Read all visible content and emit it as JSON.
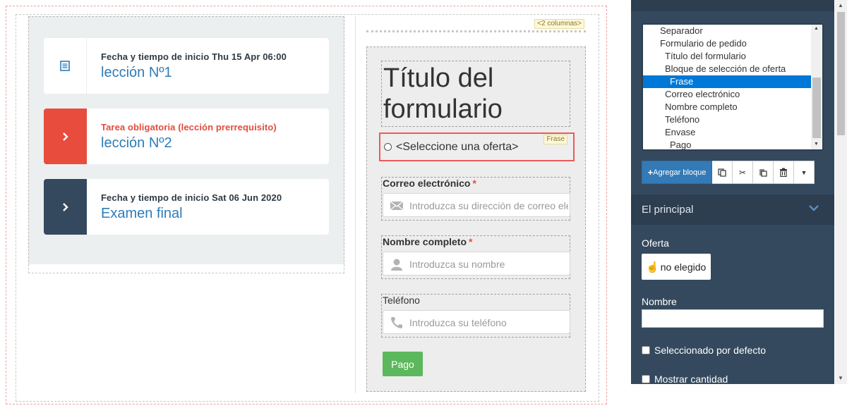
{
  "canvas": {
    "columns_tag": "<2 columnas>"
  },
  "lessons": [
    {
      "meta": "Fecha y tiempo de inicio Thu 15 Apr 06:00",
      "title": "lección Nº1",
      "icon": "document-list-icon",
      "style": "white"
    },
    {
      "meta": "Tarea obligatoria (lección prerrequisito)",
      "title": "lección Nº2",
      "icon": "chevron-right-icon",
      "style": "red"
    },
    {
      "meta": "Fecha y tiempo de inicio Sat 06 Jun 2020",
      "title": "Examen final",
      "icon": "chevron-right-icon",
      "style": "navy"
    }
  ],
  "form": {
    "title": "Título del formulario",
    "frase_tag": "Frase",
    "offer_select": "<Seleccione una oferta>",
    "email": {
      "label": "Correo electrónico",
      "required": "*",
      "placeholder": "Introduzca su dirección de correo electrónico"
    },
    "fullname": {
      "label": "Nombre completo",
      "required": "*",
      "placeholder": "Introduzca su nombre"
    },
    "phone": {
      "label": "Teléfono",
      "placeholder": "Introduzca su teléfono"
    },
    "pay_button": "Pago"
  },
  "panel": {
    "tree_items": [
      {
        "label": "Separador",
        "depth": 1,
        "selected": false
      },
      {
        "label": "Formulario de pedido",
        "depth": 1,
        "selected": false
      },
      {
        "label": "Título del formulario",
        "depth": 2,
        "selected": false
      },
      {
        "label": "Bloque de selección de oferta",
        "depth": 2,
        "selected": false
      },
      {
        "label": "Frase",
        "depth": 3,
        "selected": true
      },
      {
        "label": "Correo electrónico",
        "depth": 2,
        "selected": false
      },
      {
        "label": "Nombre completo",
        "depth": 2,
        "selected": false
      },
      {
        "label": "Teléfono",
        "depth": 2,
        "selected": false
      },
      {
        "label": "Envase",
        "depth": 2,
        "selected": false
      },
      {
        "label": "Pago",
        "depth": 3,
        "selected": false
      }
    ],
    "add_block": "Agregar bloque",
    "section_title": "El principal",
    "offer_label": "Oferta",
    "offer_value": "no elegido",
    "name_label": "Nombre",
    "name_value": "",
    "default_checkbox": "Seleccionado por defecto",
    "quantity_checkbox": "Mostrar cantidad"
  },
  "colors": {
    "accent_blue": "#337ab7",
    "panel_bg": "#34495e",
    "danger_red": "#e84c3d",
    "success_green": "#5cb85c",
    "link_blue": "#2e7bb8"
  }
}
